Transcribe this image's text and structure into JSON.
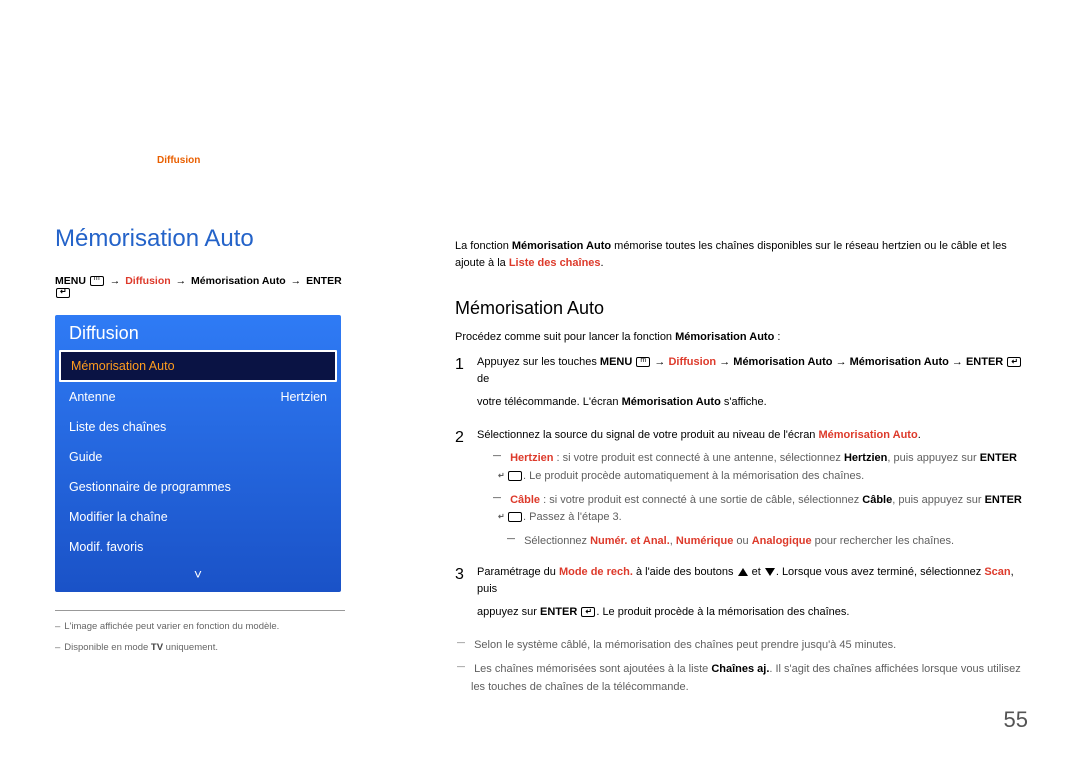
{
  "chapter": {
    "link": "Diffusion"
  },
  "left": {
    "title": "Mémorisation Auto",
    "breadcrumb": {
      "menu": "MENU",
      "a": "Diffusion",
      "b": "Mémorisation Auto",
      "enter": "ENTER"
    },
    "panel": {
      "header": "Diffusion",
      "items": [
        {
          "label": "Mémorisation Auto",
          "value": "",
          "selected": true
        },
        {
          "label": "Antenne",
          "value": "Hertzien"
        },
        {
          "label": "Liste des chaînes",
          "value": ""
        },
        {
          "label": "Guide",
          "value": ""
        },
        {
          "label": "Gestionnaire de programmes",
          "value": ""
        },
        {
          "label": "Modifier la chaîne",
          "value": ""
        },
        {
          "label": "Modif. favoris",
          "value": ""
        }
      ]
    },
    "footnotes": {
      "a": "L'image affichée peut varier en fonction du modèle.",
      "b_pre": "Disponible en mode ",
      "b_bold": "TV",
      "b_post": " uniquement."
    }
  },
  "right": {
    "intro": {
      "pre": "La fonction ",
      "fn": "Mémorisation Auto",
      "mid": " mémorise toutes les chaînes disponibles sur le réseau hertzien ou le câble et les ajoute à la ",
      "liste": "Liste des chaînes",
      "dot": "."
    },
    "section_title": "Mémorisation Auto",
    "lead": {
      "pre": "Procédez comme suit pour lancer la fonction ",
      "fn": "Mémorisation Auto",
      "post": " :"
    },
    "step1": {
      "num": "1",
      "pre": "Appuyez sur les touches ",
      "menu": "MENU",
      "diff": "Diffusion",
      "m1": "Mémorisation Auto",
      "m2": "Mémorisation Auto",
      "enter": "ENTER",
      "de": " de",
      "line2_pre": "votre télécommande. L'écran ",
      "line2_fn": "Mémorisation Auto",
      "line2_post": " s'affiche."
    },
    "step2": {
      "num": "2",
      "pre": "Sélectionnez la source du signal de votre produit au niveau de l'écran ",
      "fn": "Mémorisation Auto",
      "dot": ".",
      "dash1": {
        "hz": "Hertzien",
        "mid1": " : si votre produit est connecté à une antenne, sélectionnez ",
        "hz2": "Hertzien",
        "mid2": ", puis appuyez sur ",
        "enter": "ENTER",
        "post": ". Le produit procède automatiquement à la mémorisation des chaînes."
      },
      "dash2": {
        "cb": "Câble",
        "mid1": " : si votre produit est connecté à une sortie de câble, sélectionnez ",
        "cb2": "Câble",
        "mid2": ", puis appuyez sur ",
        "enter": "ENTER",
        "post": ". Passez à l'étape 3."
      },
      "dash3": {
        "pre": "Sélectionnez ",
        "na": "Numér. et Anal.",
        "c1": ", ",
        "num": "Numérique",
        "ou": " ou ",
        "an": "Analogique",
        "post": " pour rechercher les chaînes."
      }
    },
    "step3": {
      "num": "3",
      "pre": "Paramétrage du ",
      "mode": "Mode de rech.",
      "mid1": " à l'aide des boutons ",
      "et": " et ",
      "mid2": ". Lorsque vous avez terminé, sélectionnez ",
      "scan": "Scan",
      "mid3": ", puis",
      "line2_pre": "appuyez sur ",
      "enter": "ENTER",
      "line2_post": ". Le produit procède à la mémorisation des chaînes."
    },
    "notes": {
      "n1": "Selon le système câblé, la mémorisation des chaînes peut prendre jusqu'à 45 minutes.",
      "n2_pre": "Les chaînes mémorisées sont ajoutées à la liste ",
      "n2_bold": "Chaînes aj.",
      "n2_post": ". Il s'agit des chaînes affichées lorsque vous utilisez les touches de chaînes de la télécommande."
    }
  },
  "page_number": "55"
}
